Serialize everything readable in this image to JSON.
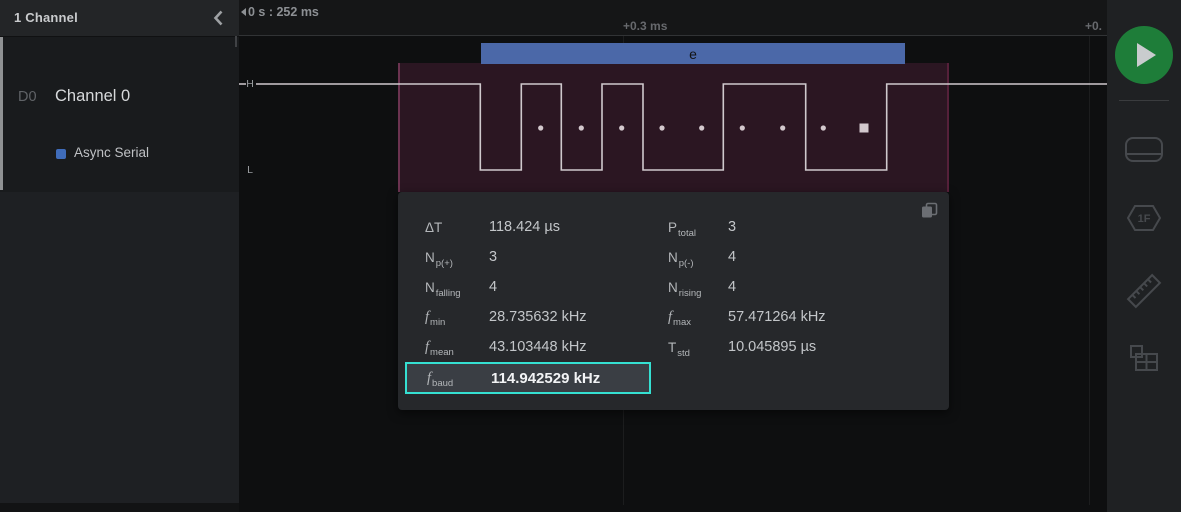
{
  "sidebar": {
    "header": "1 Channel",
    "channel_id": "D0",
    "channel_name": "Channel 0",
    "analyzer": "Async Serial"
  },
  "timeline": {
    "absolute": "0 s : 252 ms",
    "offset_1": "+0.3 ms",
    "offset_2": "+0."
  },
  "decode": {
    "byte_label": "e"
  },
  "wave": {
    "high_label": "H",
    "low_label": "L"
  },
  "panel": {
    "left": [
      {
        "main": "ΔT",
        "sub": "",
        "value": "118.424 µs"
      },
      {
        "main": "N",
        "sub": "p(+)",
        "value": "3"
      },
      {
        "main": "N",
        "sub": "falling",
        "value": "4"
      },
      {
        "main": "f",
        "sub": "min",
        "value": "28.735632 kHz"
      },
      {
        "main": "f",
        "sub": "mean",
        "value": "43.103448 kHz"
      }
    ],
    "right": [
      {
        "main": "P",
        "sub": "total",
        "value": "3"
      },
      {
        "main": "N",
        "sub": "p(-)",
        "value": "4"
      },
      {
        "main": "N",
        "sub": "rising",
        "value": "4"
      },
      {
        "main": "f",
        "sub": "max",
        "value": "57.471264 kHz"
      },
      {
        "main": "T",
        "sub": "std",
        "value": "10.045895 µs"
      }
    ],
    "baud": {
      "main": "f",
      "sub": "baud",
      "value": "114.942529 kHz"
    }
  },
  "toolbar": {
    "hex_icon_label": "1F"
  },
  "colors": {
    "accent_cyan": "#35e0d2",
    "decode_blue": "#4b68a8",
    "measure_maroon": "#2b1622",
    "play_green": "#1e7d39",
    "waveform": "#cfc9cd"
  }
}
